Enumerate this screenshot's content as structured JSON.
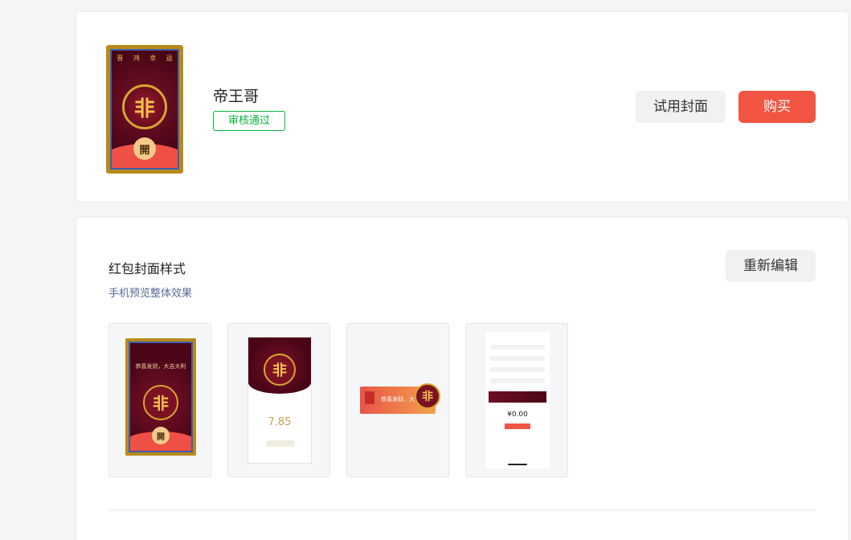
{
  "product": {
    "name": "帝王哥",
    "status": "审核通过",
    "cover_open_char": "開",
    "cover_top_chars": [
      "晋",
      "鸿",
      "幸",
      "运"
    ]
  },
  "actions": {
    "try_label": "试用封面",
    "buy_label": "购买"
  },
  "style_section": {
    "title": "红包封面样式",
    "subtitle": "手机预览整体效果",
    "reedit_label": "重新编辑"
  },
  "previews": {
    "cover_message": "恭喜发财，大吉大利",
    "open_char": "開",
    "amount": "7.85",
    "chat_message": "恭喜发财，大吉大利",
    "pay_amount": "¥0.00"
  },
  "colors": {
    "accent_green": "#07b53c",
    "buy_red": "#f25542",
    "link_blue": "#576b95"
  }
}
